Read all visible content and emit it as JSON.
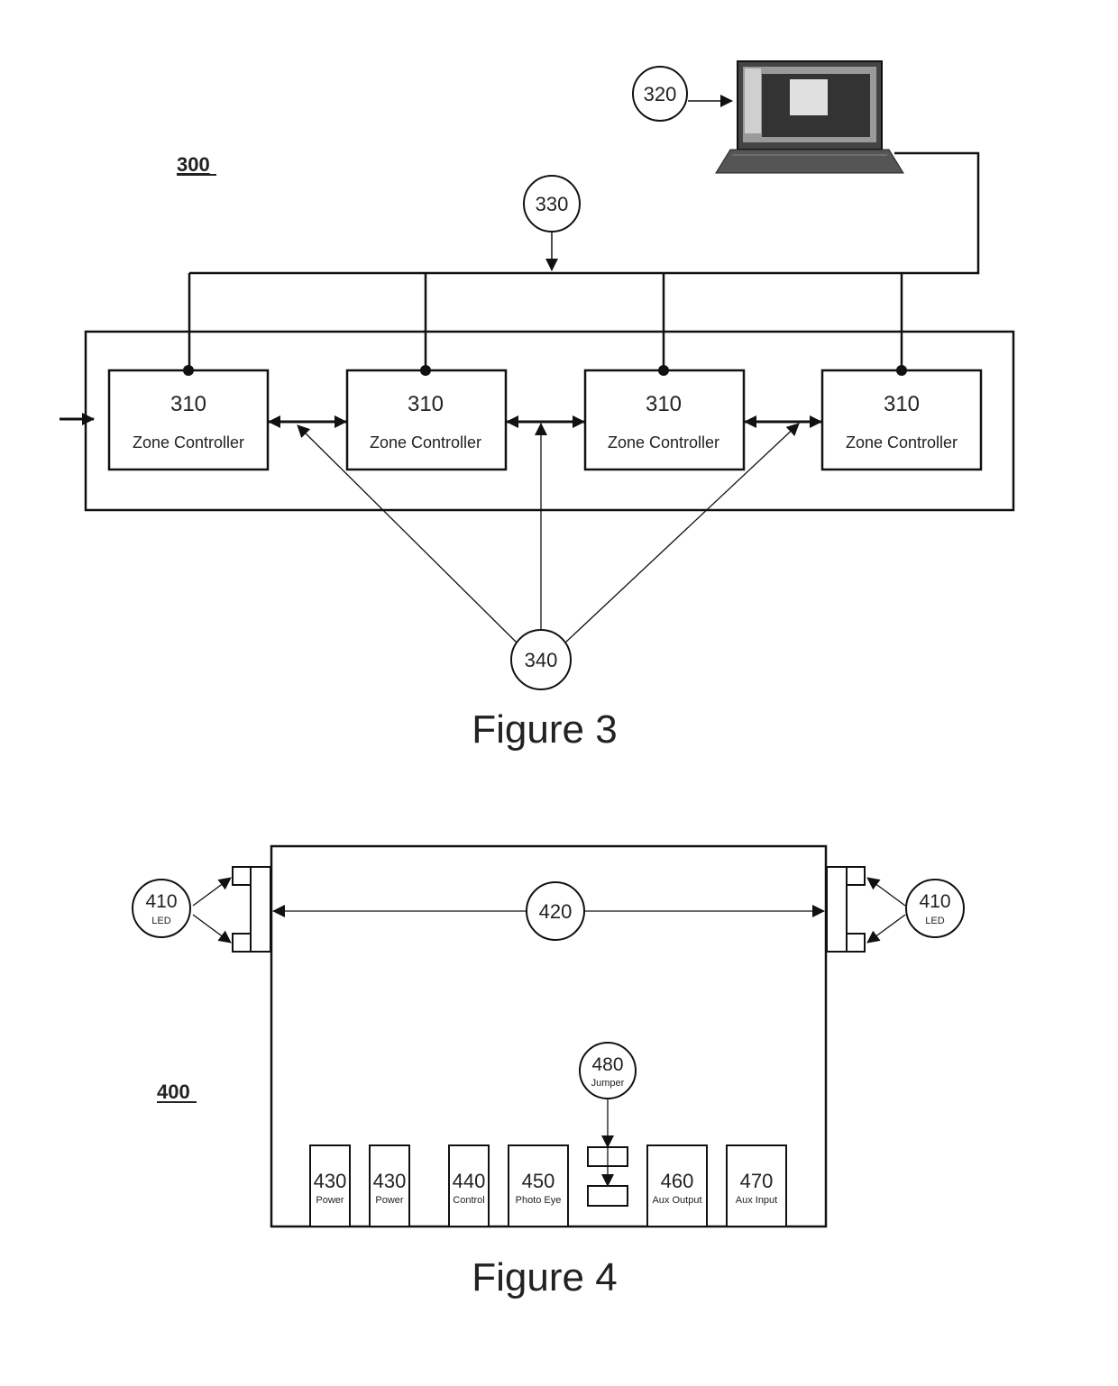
{
  "figure3": {
    "ref_label": "300",
    "caption": "Figure 3",
    "laptop_ref": "320",
    "bus_ref": "330",
    "link_ref": "340",
    "controllers": [
      {
        "ref": "310",
        "label": "Zone Controller"
      },
      {
        "ref": "310",
        "label": "Zone Controller"
      },
      {
        "ref": "310",
        "label": "Zone Controller"
      },
      {
        "ref": "310",
        "label": "Zone Controller"
      }
    ]
  },
  "figure4": {
    "ref_label": "400",
    "caption": "Figure 4",
    "led_left": {
      "ref": "410",
      "label": "LED"
    },
    "led_right": {
      "ref": "410",
      "label": "LED"
    },
    "span_ref": "420",
    "jumper": {
      "ref": "480",
      "label": "Jumper"
    },
    "ports": [
      {
        "ref": "430",
        "label": "Power"
      },
      {
        "ref": "430",
        "label": "Power"
      },
      {
        "ref": "440",
        "label": "Control"
      },
      {
        "ref": "450",
        "label": "Photo Eye"
      },
      {
        "ref": "460",
        "label": "Aux Output"
      },
      {
        "ref": "470",
        "label": "Aux Input"
      }
    ]
  }
}
